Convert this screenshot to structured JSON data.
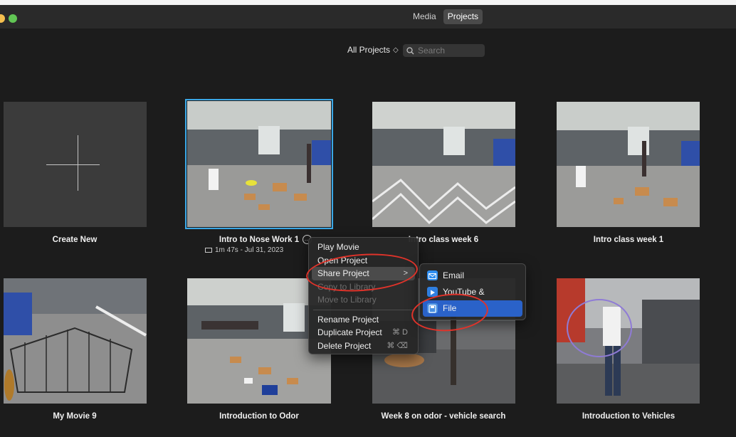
{
  "window": {
    "tabs": [
      {
        "label": "Media",
        "active": false
      },
      {
        "label": "Projects",
        "active": true
      }
    ]
  },
  "toolbar": {
    "filter_label": "All Projects",
    "filter_chevron": "◇",
    "search_placeholder": "Search"
  },
  "projects": [
    {
      "title": "Create New",
      "kind": "create"
    },
    {
      "title": "Intro to Nose Work 1",
      "selected": true,
      "duration_date": "1m 47s - Jul 31, 2023"
    },
    {
      "title": "Intro class week 6"
    },
    {
      "title": "Intro class week 1"
    },
    {
      "title": "My Movie 9"
    },
    {
      "title": "Introduction to Odor"
    },
    {
      "title": "Week 8 on odor - vehicle search"
    },
    {
      "title": "Introduction to Vehicles"
    }
  ],
  "context_menu": {
    "items": [
      {
        "label": "Play Movie"
      },
      {
        "label": "Open Project"
      },
      {
        "label": "Share Project",
        "submenu": true,
        "arrow": ">"
      },
      {
        "label": "Copy to Library",
        "disabled": true
      },
      {
        "label": "Move to Library",
        "disabled": true
      },
      {
        "label": "Rename Project"
      },
      {
        "label": "Duplicate Project",
        "shortcut": "⌘ D"
      },
      {
        "label": "Delete Project",
        "shortcut": "⌘ ⌫"
      }
    ]
  },
  "share_submenu": {
    "items": [
      {
        "label": "Email",
        "icon": "mail-icon",
        "color": "#2f8ef0"
      },
      {
        "label": "YouTube & Facebook",
        "icon": "video-share-icon",
        "color": "#2f7fe0"
      },
      {
        "label": "File",
        "icon": "file-icon",
        "color": "#4a90e2",
        "active": true
      }
    ]
  },
  "colors": {
    "selection": "#3aa7e6",
    "menu_highlight": "#2a62c9",
    "annotation": "#e0332a"
  }
}
